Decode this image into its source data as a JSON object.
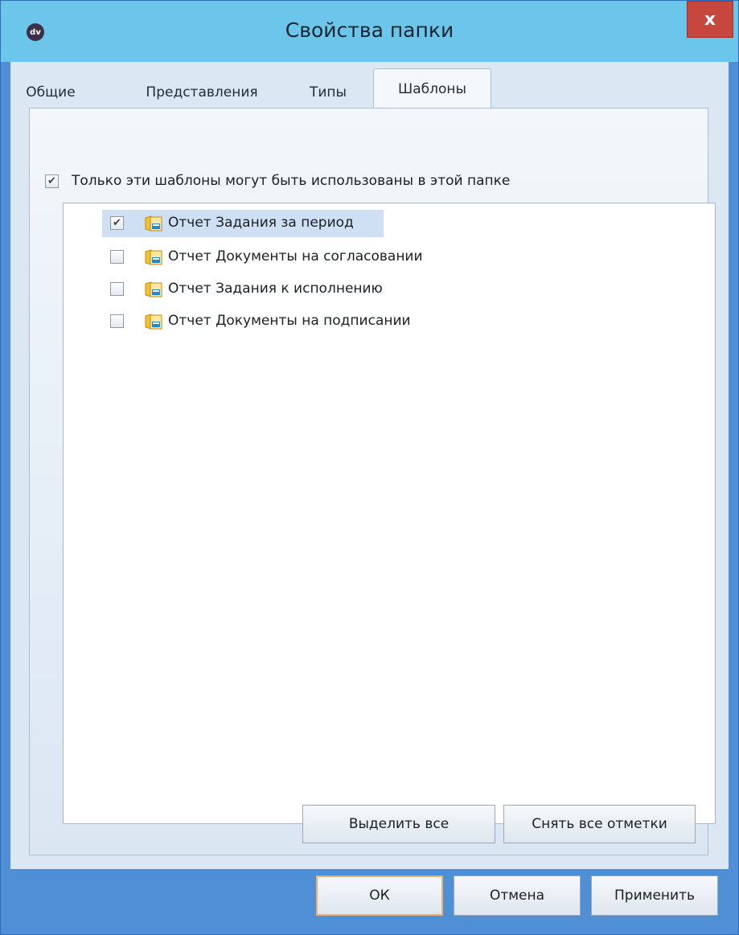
{
  "window": {
    "title": "Свойства папки",
    "app_icon_text": "dv",
    "close_label": "x"
  },
  "tabs": [
    {
      "label": "Общие",
      "active": false
    },
    {
      "label": "Представления",
      "active": false
    },
    {
      "label": "Типы",
      "active": false
    },
    {
      "label": "Шаблоны",
      "active": true
    }
  ],
  "templates_tab": {
    "only_these_label": "Только эти шаблоны могут быть использованы в этой папке",
    "only_these_checked": true,
    "items": [
      {
        "label": "Отчет Задания за период",
        "checked": true,
        "selected": true
      },
      {
        "label": "Отчет Документы на согласовании",
        "checked": false,
        "selected": false
      },
      {
        "label": "Отчет Задания к исполнению",
        "checked": false,
        "selected": false
      },
      {
        "label": "Отчет Документы на подписании",
        "checked": false,
        "selected": false
      }
    ],
    "select_all_label": "Выделить все",
    "clear_all_label": "Снять все отметки"
  },
  "footer": {
    "ok_label": "ОК",
    "cancel_label": "Отмена",
    "apply_label": "Применить"
  },
  "icons": {
    "template_icon": "document-template-icon",
    "checkbox_checked_glyph": "✔"
  },
  "colors": {
    "titlebar": "#6cc6ec",
    "frame": "#4f8fd6",
    "close_button": "#c7463e",
    "selection": "#cfe0f4"
  }
}
